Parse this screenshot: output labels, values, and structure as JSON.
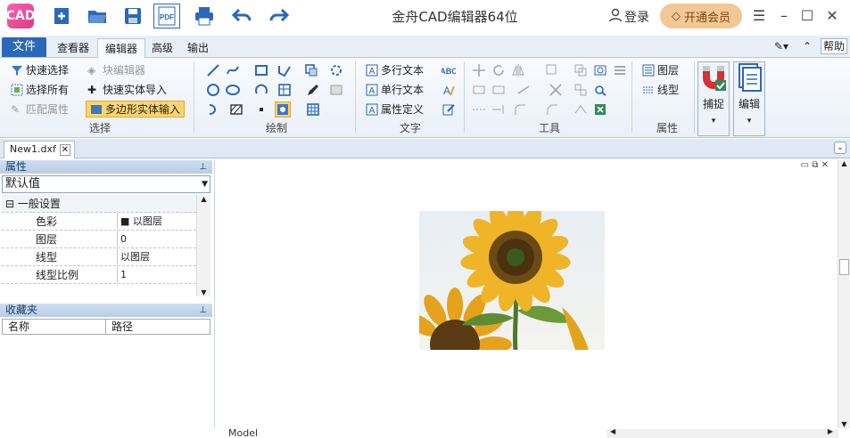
{
  "app": {
    "logo_text": "CAD",
    "title": "金舟CAD编辑器64位",
    "login": "登录",
    "vip": "开通会员"
  },
  "tabs": [
    {
      "label": "文件"
    },
    {
      "label": "查看器"
    },
    {
      "label": "编辑器"
    },
    {
      "label": "高级"
    },
    {
      "label": "输出"
    }
  ],
  "help": "帮助",
  "ribbon": {
    "select_group": {
      "quick_select": "快速选择",
      "block_editor": "块编辑器",
      "select_all": "选择所有",
      "quick_entity_import": "快速实体导入",
      "match_props": "匹配属性",
      "polygon_entity_input": "多边形实体输入",
      "label": "选择"
    },
    "draw_group": {
      "label": "绘制"
    },
    "text_group": {
      "mtext": "多行文本",
      "stext": "单行文本",
      "attdef": "属性定义",
      "label": "文字"
    },
    "tools_group": {
      "label": "工具"
    },
    "props_group": {
      "layer": "图层",
      "linetype": "线型",
      "label": "属性"
    },
    "snap": "捕捉",
    "edit": "编辑"
  },
  "doc_tab": "New1.dxf",
  "properties": {
    "title": "属性",
    "combo_value": "默认值",
    "category": "一般设置",
    "rows": [
      {
        "key": "色彩",
        "value": "■ 以图层"
      },
      {
        "key": "图层",
        "value": "0"
      },
      {
        "key": "线型",
        "value": "以图层"
      },
      {
        "key": "线型比例",
        "value": "1"
      }
    ]
  },
  "favorites": {
    "title": "收藏夹",
    "col_name": "名称",
    "col_path": "路径"
  },
  "model_tab": "Model",
  "colors": {
    "accent": "#2b68b9",
    "vip_bg": "#f4c795",
    "panel_head": "#cfdef1"
  }
}
